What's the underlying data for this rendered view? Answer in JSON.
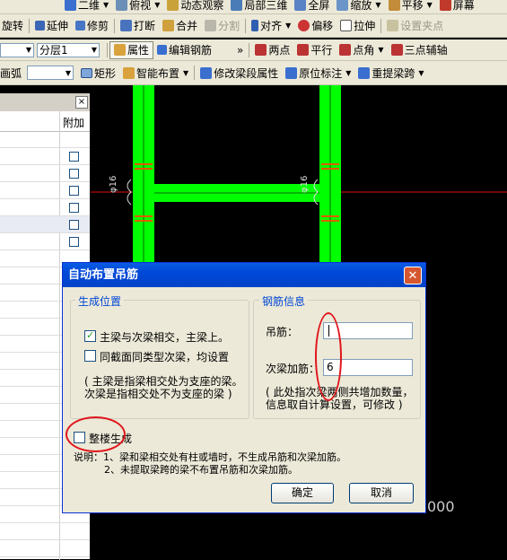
{
  "toolbar_top": {
    "items": [
      {
        "label": "二维"
      },
      {
        "label": "俯视"
      },
      {
        "label": "动态观察"
      },
      {
        "label": "局部三维"
      },
      {
        "label": "全屏"
      },
      {
        "label": "缩放"
      },
      {
        "label": "平移"
      },
      {
        "label": "屏幕"
      }
    ]
  },
  "toolbar_edit": {
    "items": [
      {
        "label": "旋转"
      },
      {
        "label": "延伸"
      },
      {
        "label": "修剪"
      },
      {
        "label": "打断"
      },
      {
        "label": "合并"
      },
      {
        "label": "分割"
      },
      {
        "label": "对齐"
      },
      {
        "label": "偏移"
      },
      {
        "label": "拉伸"
      },
      {
        "label": "设置夹点"
      }
    ]
  },
  "toolbar_props": {
    "layer_select": "分层1",
    "items": [
      {
        "label": "属性"
      },
      {
        "label": "编辑钢筋"
      },
      {
        "label": "两点"
      },
      {
        "label": "平行"
      },
      {
        "label": "点角"
      },
      {
        "label": "三点辅轴"
      }
    ],
    "more": "»"
  },
  "toolbar_draw": {
    "items": [
      {
        "label": "画弧"
      },
      {
        "label": "矩形"
      },
      {
        "label": "智能布置"
      },
      {
        "label": "修改梁段属性"
      },
      {
        "label": "原位标注"
      },
      {
        "label": "重提梁跨"
      }
    ]
  },
  "left_panel": {
    "close": "×",
    "column_header": "附加",
    "checkbox_rows": 6
  },
  "canvas": {
    "labels": [
      "φ16",
      "φ16"
    ],
    "bottom_number": "000",
    "colors": {
      "beam": "#00ff00",
      "axis": "#e01010",
      "stirrup": "#e06000",
      "background": "#000000"
    }
  },
  "dialog": {
    "title": "自动布置吊筋",
    "close": "✕",
    "position_group": {
      "title": "生成位置",
      "option1": {
        "label": "主梁与次梁相交，主梁上。",
        "checked": true
      },
      "option2": {
        "label": "同截面同类型次梁，均设置",
        "checked": false
      },
      "note_line1": "( 主梁是指梁相交处为支座的梁。",
      "note_line2": "次梁是指相交处不为支座的梁 )"
    },
    "rebar_group": {
      "title": "钢筋信息",
      "hanger_label": "吊筋：",
      "hanger_value": "",
      "extra_label": "次梁加筋：",
      "extra_value": "6",
      "note_line1": "( 此处指次梁两侧共增加数量，",
      "note_line2": "信息取自计算设置，可修改 )"
    },
    "whole_floor": {
      "label": "整楼生成",
      "checked": false
    },
    "explanation": {
      "line1": "说明：1、梁和梁相交处有柱或墙时，不生成吊筋和次梁加筋。",
      "line2": "2、未提取梁跨的梁不布置吊筋和次梁加筋。"
    },
    "ok": "确定",
    "cancel": "取消"
  }
}
